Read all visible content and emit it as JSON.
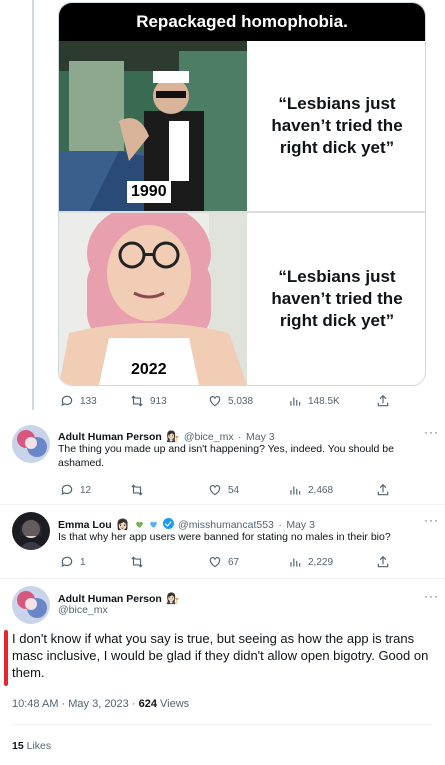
{
  "meme": {
    "title": "Repackaged homophobia.",
    "top": {
      "year": "1990",
      "quote": "“Lesbians just haven’t tried the right dick yet”"
    },
    "bottom": {
      "year": "2022",
      "quote": "“Lesbians just haven’t tried the right dick yet”"
    }
  },
  "original_stats": {
    "replies": "133",
    "retweets": "913",
    "likes": "5,038",
    "views": "148.5K"
  },
  "replies": [
    {
      "name": "Adult Human Person",
      "handle": "@bice_mx",
      "sep": "·",
      "date": "May 3",
      "text": "The thing you made up and isn't happening? Yes, indeed. You should be ashamed.",
      "stats": {
        "replies": "12",
        "retweets": "",
        "likes": "54",
        "views": "2,468"
      }
    },
    {
      "name": "Emma Lou",
      "handle": "@misshumancat553",
      "sep": "·",
      "date": "May 3",
      "text": "Is that why her app users were banned for stating no males in their bio?",
      "stats": {
        "replies": "1",
        "retweets": "",
        "likes": "67",
        "views": "2,229"
      }
    }
  ],
  "main_tweet": {
    "name": "Adult Human Person",
    "handle": "@bice_mx",
    "text": "I don't know if what you say is true, but seeing as how the app is trans masc inclusive, I would be glad if they didn't allow open bigotry. Good on them.",
    "time": "10:48 AM · May 3, 2023 · ",
    "views_count": "624",
    "views_label": " Views",
    "likes_count": "15",
    "likes_label": " Likes"
  },
  "colors": {
    "accent": "#1d9bf0",
    "muted": "#536471",
    "highlight": "#e5262d",
    "heart": "#78b159"
  },
  "icons": [
    "reply-icon",
    "retweet-icon",
    "like-icon",
    "views-icon",
    "share-icon",
    "more-icon",
    "verified-badge-icon"
  ]
}
